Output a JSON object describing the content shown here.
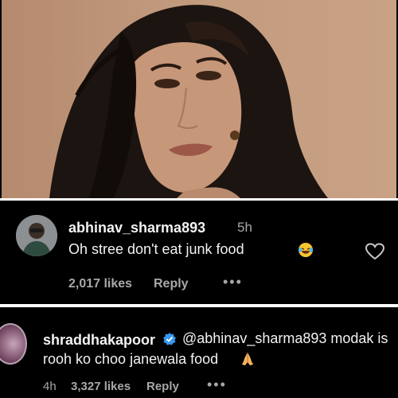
{
  "comments": [
    {
      "username": "abhinav_sharma893",
      "time": "5h",
      "text": "Oh stree don't eat junk food",
      "emoji_icon": "laughing-tears-emoji-icon",
      "likes": "2,017 likes",
      "reply_label": "Reply",
      "more_label": "•••"
    },
    {
      "username": "shraddhakapoor",
      "verified_icon": "verified-badge-icon",
      "mention": "@abhinav_sharma893",
      "text_after_mention": " modak is",
      "text_line2": "rooh ko choo janewala food",
      "emoji_icon": "folded-hands-emoji-icon",
      "time": "4h",
      "likes": "3,327 likes",
      "reply_label": "Reply",
      "more_label": "•••"
    }
  ],
  "colors": {
    "background": "#000000",
    "text": "#f2f2f2",
    "muted": "#a8a8a8",
    "verified": "#3897f0",
    "photo_bg": "#c29a7d"
  }
}
